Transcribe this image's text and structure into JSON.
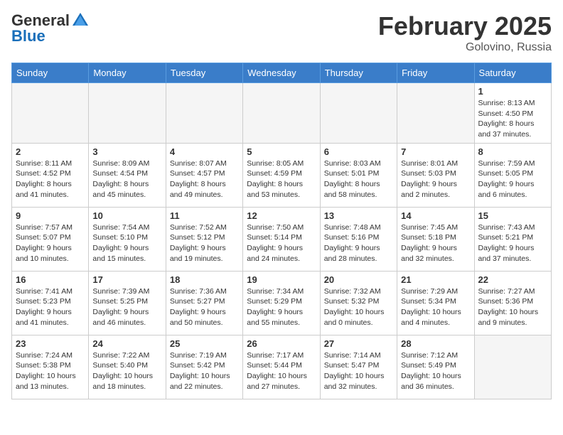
{
  "header": {
    "logo_general": "General",
    "logo_blue": "Blue",
    "month_title": "February 2025",
    "location": "Golovino, Russia"
  },
  "days_of_week": [
    "Sunday",
    "Monday",
    "Tuesday",
    "Wednesday",
    "Thursday",
    "Friday",
    "Saturday"
  ],
  "weeks": [
    [
      {
        "day": "",
        "info": ""
      },
      {
        "day": "",
        "info": ""
      },
      {
        "day": "",
        "info": ""
      },
      {
        "day": "",
        "info": ""
      },
      {
        "day": "",
        "info": ""
      },
      {
        "day": "",
        "info": ""
      },
      {
        "day": "1",
        "info": "Sunrise: 8:13 AM\nSunset: 4:50 PM\nDaylight: 8 hours and 37 minutes."
      }
    ],
    [
      {
        "day": "2",
        "info": "Sunrise: 8:11 AM\nSunset: 4:52 PM\nDaylight: 8 hours and 41 minutes."
      },
      {
        "day": "3",
        "info": "Sunrise: 8:09 AM\nSunset: 4:54 PM\nDaylight: 8 hours and 45 minutes."
      },
      {
        "day": "4",
        "info": "Sunrise: 8:07 AM\nSunset: 4:57 PM\nDaylight: 8 hours and 49 minutes."
      },
      {
        "day": "5",
        "info": "Sunrise: 8:05 AM\nSunset: 4:59 PM\nDaylight: 8 hours and 53 minutes."
      },
      {
        "day": "6",
        "info": "Sunrise: 8:03 AM\nSunset: 5:01 PM\nDaylight: 8 hours and 58 minutes."
      },
      {
        "day": "7",
        "info": "Sunrise: 8:01 AM\nSunset: 5:03 PM\nDaylight: 9 hours and 2 minutes."
      },
      {
        "day": "8",
        "info": "Sunrise: 7:59 AM\nSunset: 5:05 PM\nDaylight: 9 hours and 6 minutes."
      }
    ],
    [
      {
        "day": "9",
        "info": "Sunrise: 7:57 AM\nSunset: 5:07 PM\nDaylight: 9 hours and 10 minutes."
      },
      {
        "day": "10",
        "info": "Sunrise: 7:54 AM\nSunset: 5:10 PM\nDaylight: 9 hours and 15 minutes."
      },
      {
        "day": "11",
        "info": "Sunrise: 7:52 AM\nSunset: 5:12 PM\nDaylight: 9 hours and 19 minutes."
      },
      {
        "day": "12",
        "info": "Sunrise: 7:50 AM\nSunset: 5:14 PM\nDaylight: 9 hours and 24 minutes."
      },
      {
        "day": "13",
        "info": "Sunrise: 7:48 AM\nSunset: 5:16 PM\nDaylight: 9 hours and 28 minutes."
      },
      {
        "day": "14",
        "info": "Sunrise: 7:45 AM\nSunset: 5:18 PM\nDaylight: 9 hours and 32 minutes."
      },
      {
        "day": "15",
        "info": "Sunrise: 7:43 AM\nSunset: 5:21 PM\nDaylight: 9 hours and 37 minutes."
      }
    ],
    [
      {
        "day": "16",
        "info": "Sunrise: 7:41 AM\nSunset: 5:23 PM\nDaylight: 9 hours and 41 minutes."
      },
      {
        "day": "17",
        "info": "Sunrise: 7:39 AM\nSunset: 5:25 PM\nDaylight: 9 hours and 46 minutes."
      },
      {
        "day": "18",
        "info": "Sunrise: 7:36 AM\nSunset: 5:27 PM\nDaylight: 9 hours and 50 minutes."
      },
      {
        "day": "19",
        "info": "Sunrise: 7:34 AM\nSunset: 5:29 PM\nDaylight: 9 hours and 55 minutes."
      },
      {
        "day": "20",
        "info": "Sunrise: 7:32 AM\nSunset: 5:32 PM\nDaylight: 10 hours and 0 minutes."
      },
      {
        "day": "21",
        "info": "Sunrise: 7:29 AM\nSunset: 5:34 PM\nDaylight: 10 hours and 4 minutes."
      },
      {
        "day": "22",
        "info": "Sunrise: 7:27 AM\nSunset: 5:36 PM\nDaylight: 10 hours and 9 minutes."
      }
    ],
    [
      {
        "day": "23",
        "info": "Sunrise: 7:24 AM\nSunset: 5:38 PM\nDaylight: 10 hours and 13 minutes."
      },
      {
        "day": "24",
        "info": "Sunrise: 7:22 AM\nSunset: 5:40 PM\nDaylight: 10 hours and 18 minutes."
      },
      {
        "day": "25",
        "info": "Sunrise: 7:19 AM\nSunset: 5:42 PM\nDaylight: 10 hours and 22 minutes."
      },
      {
        "day": "26",
        "info": "Sunrise: 7:17 AM\nSunset: 5:44 PM\nDaylight: 10 hours and 27 minutes."
      },
      {
        "day": "27",
        "info": "Sunrise: 7:14 AM\nSunset: 5:47 PM\nDaylight: 10 hours and 32 minutes."
      },
      {
        "day": "28",
        "info": "Sunrise: 7:12 AM\nSunset: 5:49 PM\nDaylight: 10 hours and 36 minutes."
      },
      {
        "day": "",
        "info": ""
      }
    ]
  ]
}
